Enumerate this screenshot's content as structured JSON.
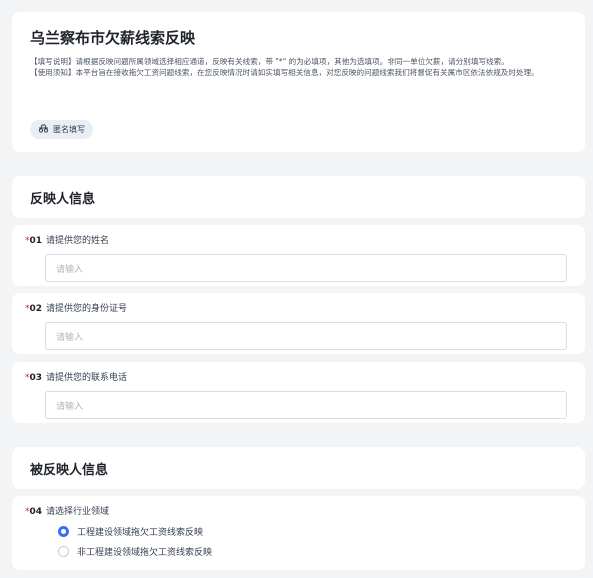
{
  "form": {
    "title": "乌兰察布市欠薪线索反映",
    "instructions": "【填写说明】请根据反映问题所属领域选择相应通道，反映有关线索，带 \"*\" 的为必填项，其他为选填项。非同一单位欠薪，请分别填写线索。",
    "notice": "【使用须知】本平台旨在接收拖欠工资问题线索，在您反映情况时请如实填写相关信息，对您反映的问题线索我们将督促有关属市区依法依规及时处理。",
    "anonymous_label": "匿名填写"
  },
  "sections": {
    "reporter": "反映人信息",
    "reported": "被反映人信息"
  },
  "questions": [
    {
      "required_mark": "*",
      "number": "01",
      "label": "请提供您的姓名",
      "placeholder": "请输入"
    },
    {
      "required_mark": "*",
      "number": "02",
      "label": "请提供您的身份证号",
      "placeholder": "请输入"
    },
    {
      "required_mark": "*",
      "number": "03",
      "label": "请提供您的联系电话",
      "placeholder": "请输入"
    },
    {
      "required_mark": "*",
      "number": "04",
      "label": "请选择行业领域"
    }
  ],
  "industry_options": [
    {
      "label": "工程建设领域拖欠工资线索反映",
      "selected": true
    },
    {
      "label": "非工程建设领域拖欠工资线索反映",
      "selected": false
    }
  ],
  "colors": {
    "accent": "#3b6ef5",
    "required": "#e02020",
    "background": "#f3f4f6"
  }
}
